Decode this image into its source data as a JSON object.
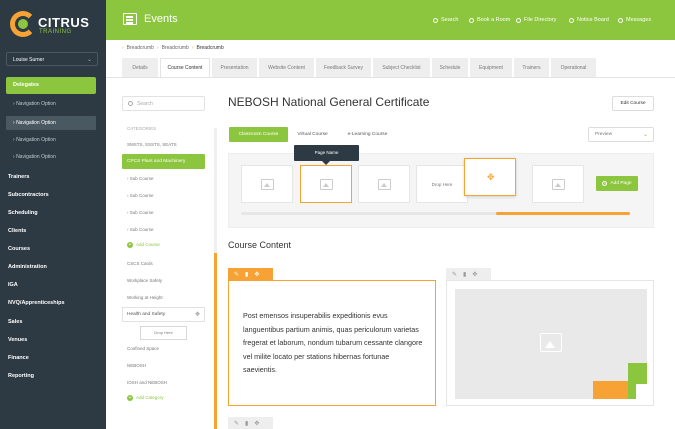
{
  "brand": {
    "name": "CITRUS",
    "sub": "TRAINING"
  },
  "sidebar": {
    "user": "Louise Surner",
    "active": "Delegates",
    "sub_items": [
      "Navigation Option",
      "Navigation Option",
      "Navigation Option",
      "Navigation Option"
    ],
    "items": [
      "Trainers",
      "Subcontractors",
      "Scheduling",
      "Clients",
      "Courses",
      "Administration",
      "IGA",
      "NVQ/Apprenticeships",
      "Sales",
      "Venues",
      "Finance",
      "Reporting"
    ]
  },
  "header": {
    "title": "Events",
    "nav": [
      "Search",
      "Book a Room",
      "File Directory",
      "Notice Board",
      "Messages"
    ]
  },
  "breadcrumb": [
    "Breadcrumb",
    "Breadcrumb",
    "Breadcrumb"
  ],
  "tabs": [
    "Details",
    "Course Content",
    "Presentation",
    "Website Content",
    "Feedback Survey",
    "Subject Checklist",
    "Schedule",
    "Equipment",
    "Trainers",
    "Operational"
  ],
  "tree": {
    "search_placeholder": "Search",
    "heading": "CATEGORIES",
    "cat1": "SMSTS, SSSTS, SEATS",
    "active": "CPCS Plant and Machinery",
    "subs": [
      "Sub Course",
      "Sub Course",
      "Sub Course",
      "Sub Course"
    ],
    "add_course": "Add Course",
    "items": [
      "CSCS Cards",
      "Workplace Safety",
      "Working at Height"
    ],
    "box": "Health and Safety",
    "drop_here": "Drop Here",
    "items2": [
      "Confined Space",
      "NEBOSH",
      "IOSH and NEBOSH"
    ],
    "add_category": "Add Category"
  },
  "main": {
    "title": "NEBOSH National General Certificate",
    "edit_button": "Edit Course",
    "content_tabs": [
      "Classroom Course",
      "Virtual Course",
      "e-Learning Course"
    ],
    "preview": "Preview",
    "tooltip": "Page Name",
    "drop_here": "Drop Here",
    "add_page": "Add Page",
    "section_title": "Course Content",
    "paragraph": "Post emensos insuperabilis expeditionis evus languentibus partium animis, quas periculorum varietas fregerat et laborum, nondum tubarum cessante clangore vel milite locato per stations hibernas fortunae saevientis."
  },
  "colors": {
    "green": "#8cc63f",
    "orange": "#f7a234",
    "dark": "#2d3a43"
  }
}
